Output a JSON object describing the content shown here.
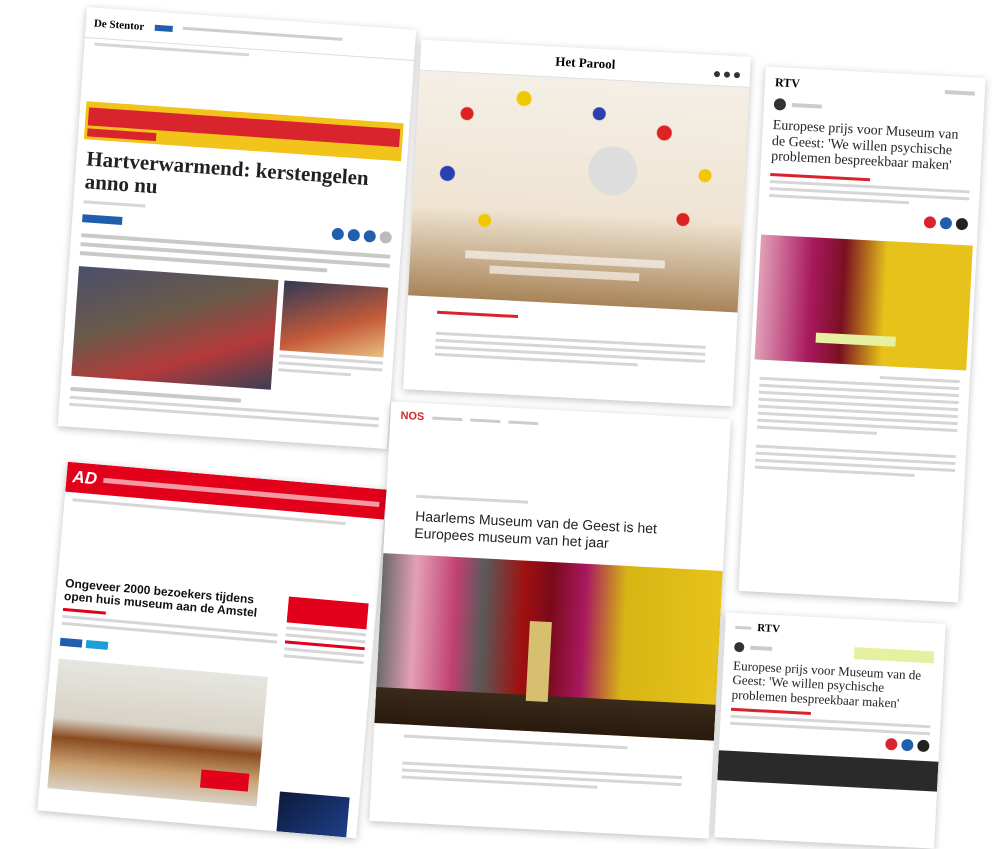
{
  "card1": {
    "masthead": "De Stentor",
    "headline": "Hartverwarmend: kerstengelen anno nu"
  },
  "card2": {
    "masthead": "Het Parool"
  },
  "card3": {
    "logo": "RTV",
    "headline": "Europese prijs voor Museum van de Geest: 'We willen psychische problemen bespreekbaar maken'"
  },
  "card4": {
    "logo": "AD",
    "headline": "Ongeveer 2000 bezoekers tijdens open huis museum aan de Amstel"
  },
  "card5": {
    "logo": "NOS",
    "headline": "Haarlems Museum van de Geest is het Europees museum van het jaar"
  },
  "card6": {
    "logo": "RTV",
    "headline": "Europese prijs voor Museum van de Geest: 'We willen psychische problemen bespreekbaar maken'"
  },
  "colors": {
    "ad_red": "#e2001a",
    "alert_red": "#d9232d",
    "alert_yellow": "#f2c31a",
    "accent_blue": "#1f5fae",
    "museum_yellow": "#e7c21a",
    "museum_magenta": "#a8185f"
  }
}
